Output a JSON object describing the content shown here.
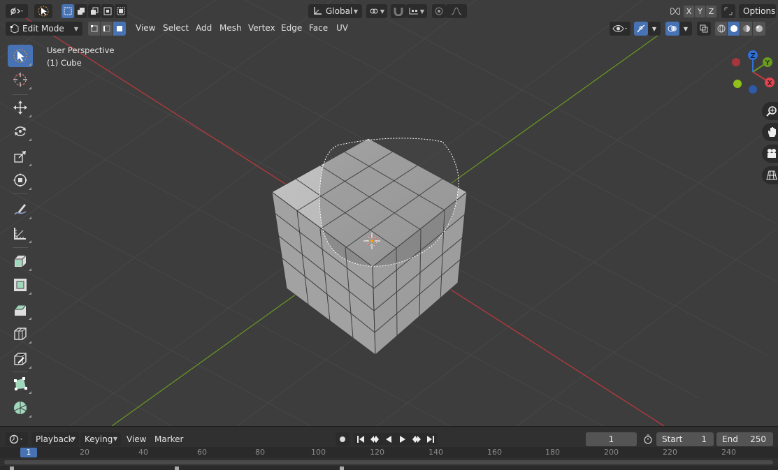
{
  "header": {
    "pivot_orientation": "Global",
    "options_label": "Options",
    "axis_x": "X",
    "axis_y": "Y",
    "axis_z": "Z"
  },
  "mode_bar": {
    "mode": "Edit Mode",
    "menus": [
      "View",
      "Select",
      "Add",
      "Mesh",
      "Vertex",
      "Edge",
      "Face",
      "UV"
    ]
  },
  "viewport": {
    "perspective": "User Perspective",
    "object": "(1) Cube",
    "gizmo": {
      "x": "X",
      "y": "Y",
      "z": "Z"
    }
  },
  "toolbar": {
    "tools": [
      "select-box",
      "cursor",
      "move",
      "rotate",
      "scale",
      "transform",
      "annotate",
      "measure",
      "extrude-region",
      "inset-faces",
      "bevel",
      "loop-cut",
      "knife",
      "poly-build",
      "spin"
    ],
    "active": "select-box"
  },
  "timeline": {
    "menus": {
      "playback": "Playback",
      "keying": "Keying",
      "view": "View",
      "marker": "Marker"
    },
    "current_frame": "1",
    "start_label": "Start",
    "start_value": "1",
    "end_label": "End",
    "end_value": "250",
    "ruler_current": "1",
    "ruler_labels": [
      "20",
      "40",
      "60",
      "80",
      "100",
      "120",
      "140",
      "160",
      "180",
      "200",
      "220",
      "240"
    ]
  },
  "colors": {
    "background": "#3d3d3d",
    "header": "#303030",
    "active_blue": "#4772b3",
    "axis_x_red": "#c0393d",
    "axis_y_green": "#6a9a1f",
    "axis_z_blue": "#2f6fd6",
    "mesh_face": "#b4b4b4"
  }
}
